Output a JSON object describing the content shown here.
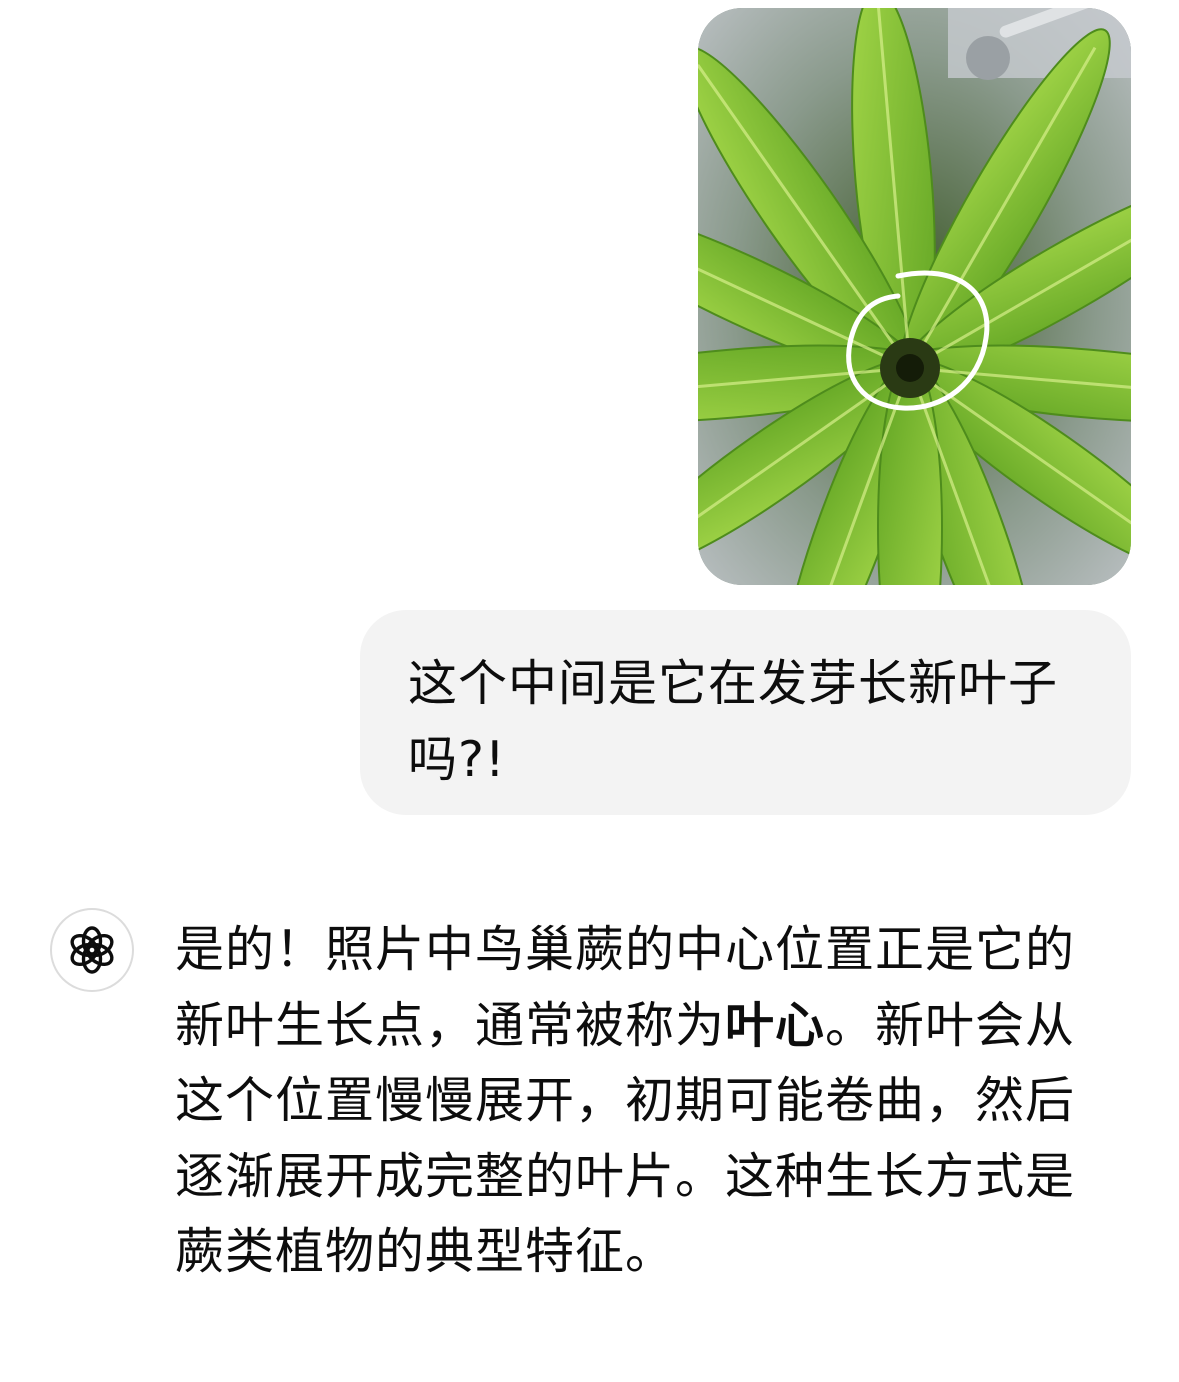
{
  "user_message": {
    "image": "photo-bird-nest-fern-center-circled",
    "text": "这个中间是它在发芽长新叶子吗?!"
  },
  "assistant_message": {
    "avatar_icon": "openai-logo-icon",
    "part1": "是的！照片中鸟巢蕨的中心位置正是它的新叶生长点，通常被称为",
    "bold": "叶心",
    "part2": "。新叶会从这个位置慢慢展开，初期可能卷曲，然后逐渐展开成完整的叶片。这种生长方式是蕨类植物的典型特征。"
  },
  "colors": {
    "bubble_bg": "#f3f3f3",
    "text": "#0d0d0d",
    "avatar_border": "#dcdcdc",
    "leaf": "#7bc12e"
  }
}
